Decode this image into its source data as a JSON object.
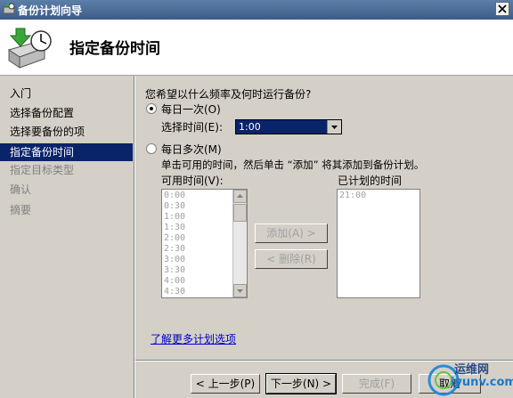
{
  "window": {
    "title": "备份计划向导"
  },
  "header": {
    "title": "指定备份时间"
  },
  "nav": {
    "items": [
      {
        "label": "入门",
        "state": "normal"
      },
      {
        "label": "选择备份配置",
        "state": "normal"
      },
      {
        "label": "选择要备份的项",
        "state": "normal"
      },
      {
        "label": "指定备份时间",
        "state": "active"
      },
      {
        "label": "指定目标类型",
        "state": "disabled"
      },
      {
        "label": "确认",
        "state": "disabled"
      },
      {
        "label": "摘要",
        "state": "disabled"
      }
    ]
  },
  "main": {
    "question": "您希望以什么频率及何时运行备份?",
    "once_daily": {
      "label": "每日一次(O)",
      "selected": true
    },
    "select_time_label": "选择时间(E):",
    "select_time_value": "1:00",
    "multiple_daily": {
      "label": "每日多次(M)",
      "selected": false
    },
    "instructions": "单击可用的时间，然后单击 “添加” 将其添加到备份计划。",
    "available_label": "可用时间(V):",
    "available_times": [
      "0:00",
      "0:30",
      "1:00",
      "1:30",
      "2:00",
      "2:30",
      "3:00",
      "3:30",
      "4:00",
      "4:30"
    ],
    "add_button": "添加(A) >",
    "remove_button": "< 删除(R)",
    "scheduled_label": "已计划的时间",
    "scheduled_times": [
      "21:00"
    ],
    "more_link": "了解更多计划选项"
  },
  "footer": {
    "back": "< 上一步(P)",
    "next": "下一步(N) >",
    "finish": "完成(F)",
    "cancel": "取消"
  },
  "watermark": {
    "text": "运维网",
    "url": "iyunv.com"
  }
}
